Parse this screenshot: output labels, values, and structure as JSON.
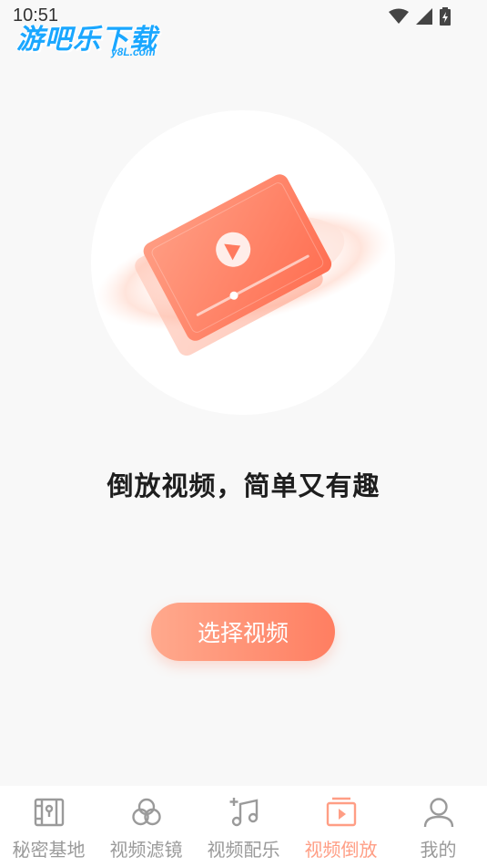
{
  "status_bar": {
    "time": "10:51"
  },
  "watermark": {
    "brand": "游吧乐下载",
    "domain": "y8L.com"
  },
  "main": {
    "headline": "倒放视频，简单又有趣",
    "select_button": "选择视频"
  },
  "colors": {
    "accent": "#ff8e72",
    "tab_inactive": "#9a9a9a"
  },
  "tabs": [
    {
      "label": "秘密基地",
      "icon": "safe-icon",
      "active": false
    },
    {
      "label": "视频滤镜",
      "icon": "filter-icon",
      "active": false
    },
    {
      "label": "视频配乐",
      "icon": "music-note-icon",
      "active": false
    },
    {
      "label": "视频倒放",
      "icon": "play-square-icon",
      "active": true
    },
    {
      "label": "我的",
      "icon": "user-icon",
      "active": false
    }
  ]
}
